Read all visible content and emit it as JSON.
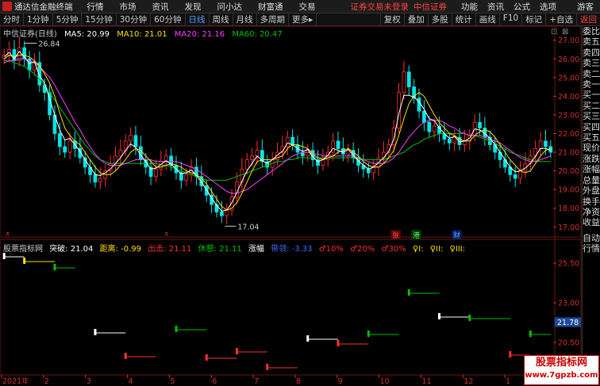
{
  "menu": {
    "app_title": "通达信金融终端",
    "items": [
      "行情",
      "市场",
      "资讯",
      "发现",
      "问小达",
      "财富通",
      "交易"
    ],
    "notice": "证券交易未登录",
    "broker": "中信证券",
    "right_items": [
      "功能",
      "资讯",
      "公式",
      "选项"
    ],
    "guest": "游客"
  },
  "toolbar": {
    "periods": [
      "分时",
      "1分钟",
      "5分钟",
      "15分钟",
      "30分钟",
      "60分钟",
      "日线",
      "周线",
      "月线",
      "多周期",
      "更多"
    ],
    "active_period": "日线",
    "more_arrow": "▸",
    "right_buttons": [
      "复权",
      "叠加",
      "多股",
      "统计",
      "画线",
      "F10",
      "标记",
      "+自选",
      "返回"
    ]
  },
  "window_controls": {
    "restore": "⊡",
    "close": "⊠"
  },
  "legend": {
    "name": "中信证券(日线)",
    "ma5": "MA5: 20.99",
    "ma10": "MA10: 21.01",
    "ma20": "MA20: 21.16",
    "ma60": "MA60: 20.47"
  },
  "price_labels": {
    "high": "26.84",
    "low": "17.04",
    "current": "21.78"
  },
  "markers": {
    "m1": "ㅈ",
    "m2": "ㅈ",
    "zhang": "张",
    "gang": "港",
    "cai": "财",
    "icon_names": [
      "alert-triangle-icon",
      "alert-triangle-icon",
      "event-zhang-icon",
      "event-gang-icon",
      "event-cai-icon"
    ]
  },
  "indicator": {
    "name": "股票指标网",
    "tupo": "突破: 21.04",
    "julibl": "距离: -0.99",
    "chuji": "出击: 21.11",
    "xiuqi": "休憩: 21.11",
    "zhangfu": "涨幅",
    "dailing": "带领: -3.33",
    "p10": "♂10%",
    "p20": "♂20%",
    "p30": "♂30%",
    "q1": "♀I:",
    "q2": "♀II:",
    "q3": "♀III:"
  },
  "side_panel": [
    "委比",
    "卖五",
    "卖四",
    "卖三",
    "卖二",
    "卖一",
    "买一",
    "买二",
    "买三",
    "买四",
    "买五",
    "现价",
    "涨跌",
    "涨幅",
    "总量",
    "外盘",
    "换手",
    "净资",
    "收益"
  ],
  "side_panel_lower": [
    "自动",
    "行情"
  ],
  "watermark": {
    "line1": "股票指标网",
    "line2": "www.7gpzb.com"
  },
  "colors": {
    "up": "#ff3030",
    "down": "#00e6e6",
    "ma5": "#ffffff",
    "ma10": "#ffe000",
    "ma20": "#ff40ff",
    "ma60": "#00c000",
    "grid": "#6a1818",
    "axis_text": "#d03030"
  },
  "chart_data": [
    {
      "type": "candlestick",
      "title": "中信证券(日线)",
      "ylim": [
        16.8,
        27.2
      ],
      "y_ticks": [
        "27.00",
        "26.00",
        "25.00",
        "24.00",
        "23.00",
        "22.00",
        "21.00",
        "20.00",
        "19.00",
        "18.00",
        "17.00"
      ],
      "x_ticks": [
        "2021年",
        "2",
        "3",
        "4",
        "5",
        "6",
        "7",
        "8",
        "9",
        "10",
        "11",
        "12",
        "1",
        "2"
      ],
      "close_series": [
        26.2,
        26.5,
        25.9,
        26.6,
        26.0,
        25.4,
        25.8,
        24.6,
        24.2,
        23.0,
        22.0,
        21.3,
        21.0,
        21.6,
        21.2,
        20.7,
        20.2,
        19.8,
        19.4,
        19.6,
        20.0,
        20.4,
        20.8,
        21.1,
        21.6,
        21.9,
        21.3,
        20.6,
        20.2,
        19.7,
        20.1,
        20.5,
        20.8,
        20.3,
        19.9,
        19.5,
        19.8,
        20.2,
        19.7,
        19.2,
        18.7,
        18.2,
        17.8,
        17.6,
        17.9,
        18.6,
        19.4,
        20.1,
        20.6,
        20.8,
        21.1,
        20.5,
        20.2,
        20.6,
        21.0,
        21.3,
        21.8,
        21.4,
        21.0,
        20.8,
        21.1,
        20.6,
        20.3,
        20.6,
        21.0,
        21.6,
        21.2,
        20.9,
        21.1,
        20.7,
        20.3,
        20.1,
        19.9,
        20.2,
        20.7,
        21.0,
        21.4,
        22.3,
        24.2,
        25.3,
        24.5,
        23.9,
        23.2,
        22.6,
        22.1,
        22.4,
        22.0,
        21.7,
        21.5,
        21.8,
        21.4,
        21.6,
        21.9,
        22.6,
        22.3,
        21.8,
        21.4,
        21.0,
        20.6,
        20.2,
        19.8,
        19.6,
        20.0,
        20.4,
        20.8,
        21.2,
        21.6,
        21.3,
        21.0
      ],
      "ma5_series": [
        26.0,
        26.2,
        26.1,
        26.2,
        26.2,
        26.1,
        25.9,
        25.6,
        25.2,
        24.7,
        24.0,
        23.1,
        22.3,
        21.9,
        21.6,
        21.4,
        21.0,
        20.6,
        20.2,
        19.9,
        19.8,
        19.8,
        20.0,
        20.3,
        20.6,
        21.0,
        21.2,
        21.1,
        20.8,
        20.5,
        20.2,
        20.2,
        20.3,
        20.4,
        20.3,
        20.2,
        20.0,
        19.9,
        19.8,
        19.6,
        19.3,
        18.9,
        18.5,
        18.1,
        17.9,
        18.0,
        18.3,
        18.8,
        19.4,
        20.0,
        20.5,
        20.6,
        20.6,
        20.6,
        20.7,
        20.8,
        21.2,
        21.4,
        21.4,
        21.3,
        21.2,
        20.9,
        20.7,
        20.6,
        20.7,
        20.8,
        21.0,
        21.1,
        21.2,
        21.0,
        20.8,
        20.5,
        20.3,
        20.2,
        20.2,
        20.4,
        20.7,
        21.1,
        21.9,
        22.8,
        23.6,
        24.0,
        24.2,
        24.0,
        23.5,
        23.0,
        22.6,
        22.3,
        22.0,
        21.9,
        21.7,
        21.6,
        21.6,
        21.9,
        22.1,
        22.2,
        22.1,
        21.8,
        21.4,
        21.0,
        20.6,
        20.3,
        20.0,
        19.9,
        20.0,
        20.4,
        20.8,
        21.1,
        21.2
      ],
      "ma20_series": [
        25.8,
        25.9,
        25.9,
        26.0,
        26.0,
        25.9,
        25.8,
        25.6,
        25.3,
        25.0,
        24.6,
        24.1,
        23.6,
        23.1,
        22.6,
        22.2,
        21.7,
        21.3,
        20.9,
        20.6,
        20.4,
        20.3,
        20.3,
        20.3,
        20.4,
        20.5,
        20.6,
        20.6,
        20.6,
        20.6,
        20.5,
        20.5,
        20.5,
        20.5,
        20.5,
        20.4,
        20.3,
        20.2,
        20.1,
        19.9,
        19.7,
        19.5,
        19.3,
        19.1,
        18.9,
        18.8,
        18.8,
        18.9,
        19.0,
        19.2,
        19.4,
        19.6,
        19.8,
        20.0,
        20.2,
        20.4,
        20.6,
        20.8,
        20.9,
        21.0,
        21.0,
        20.9,
        20.9,
        20.8,
        20.8,
        20.8,
        20.8,
        20.8,
        20.8,
        20.8,
        20.7,
        20.6,
        20.5,
        20.4,
        20.4,
        20.4,
        20.5,
        20.7,
        21.0,
        21.4,
        21.8,
        22.1,
        22.4,
        22.6,
        22.7,
        22.7,
        22.7,
        22.6,
        22.4,
        22.3,
        22.1,
        22.0,
        21.9,
        21.9,
        21.9,
        21.8,
        21.7,
        21.6,
        21.5,
        21.3,
        21.1,
        20.9,
        20.7,
        20.6,
        20.5,
        20.5,
        20.6,
        20.7,
        20.8
      ],
      "ma60_series": [
        25.9,
        25.9,
        25.8,
        25.7,
        25.6,
        25.4,
        25.2,
        24.9,
        24.6,
        24.2,
        23.8,
        23.4,
        23.0,
        22.6,
        22.2,
        21.8,
        21.4,
        21.1,
        20.8,
        20.6,
        20.5,
        20.4,
        20.4,
        20.4,
        20.4,
        20.4,
        20.4,
        20.4,
        20.4,
        20.4,
        20.4,
        20.3,
        20.3,
        20.2,
        20.1,
        20.0,
        19.9,
        19.8,
        19.7,
        19.6,
        19.5,
        19.5,
        19.5,
        19.5,
        19.5,
        19.6,
        19.7,
        19.8,
        19.9,
        20.0,
        20.1,
        20.2,
        20.3,
        20.4,
        20.5,
        20.5,
        20.6,
        20.6,
        20.7,
        20.7,
        20.7,
        20.7,
        20.7,
        20.7,
        20.7,
        20.7,
        20.7,
        20.7,
        20.7,
        20.7,
        20.6,
        20.6,
        20.6,
        20.6,
        20.6,
        20.6,
        20.7,
        20.8,
        20.9,
        21.0,
        21.2,
        21.4,
        21.5,
        21.7,
        21.8,
        21.9,
        22.0,
        22.0,
        22.0,
        22.0,
        22.0,
        22.0,
        21.9,
        21.9,
        21.8,
        21.7,
        21.6,
        21.5,
        21.3,
        21.2,
        21.0,
        20.9,
        20.8,
        20.7,
        20.6,
        20.5,
        20.5,
        20.5,
        20.5
      ]
    },
    {
      "type": "step",
      "title": "股票指标网",
      "ylim": [
        18.6,
        26.2
      ],
      "y_ticks": [
        "25.50",
        "23.00",
        "20.50",
        "19.50"
      ],
      "levels": [
        {
          "from": 0,
          "to": 4,
          "value": 25.9,
          "color": "#ffffff"
        },
        {
          "from": 4,
          "to": 10,
          "value": 25.6,
          "color": "#ffe000"
        },
        {
          "from": 10,
          "to": 14,
          "value": 25.2,
          "color": "#00c000"
        },
        {
          "from": 18,
          "to": 24,
          "value": 21.1,
          "color": "#ffffff"
        },
        {
          "from": 24,
          "to": 30,
          "value": 19.6,
          "color": "#ff3030"
        },
        {
          "from": 34,
          "to": 40,
          "value": 21.3,
          "color": "#00c000"
        },
        {
          "from": 40,
          "to": 46,
          "value": 19.5,
          "color": "#ff3030"
        },
        {
          "from": 46,
          "to": 52,
          "value": 19.9,
          "color": "#ff3030"
        },
        {
          "from": 52,
          "to": 58,
          "value": 18.9,
          "color": "#ff3030"
        },
        {
          "from": 60,
          "to": 66,
          "value": 20.7,
          "color": "#ffffff"
        },
        {
          "from": 66,
          "to": 72,
          "value": 20.4,
          "color": "#ff3030"
        },
        {
          "from": 72,
          "to": 78,
          "value": 21.0,
          "color": "#00c000"
        },
        {
          "from": 80,
          "to": 86,
          "value": 23.6,
          "color": "#00c000"
        },
        {
          "from": 86,
          "to": 92,
          "value": 22.1,
          "color": "#ffffff"
        },
        {
          "from": 92,
          "to": 100,
          "value": 22.0,
          "color": "#00c000"
        },
        {
          "from": 100,
          "to": 104,
          "value": 19.7,
          "color": "#ff3030"
        },
        {
          "from": 104,
          "to": 108,
          "value": 21.0,
          "color": "#00c000"
        }
      ]
    }
  ]
}
